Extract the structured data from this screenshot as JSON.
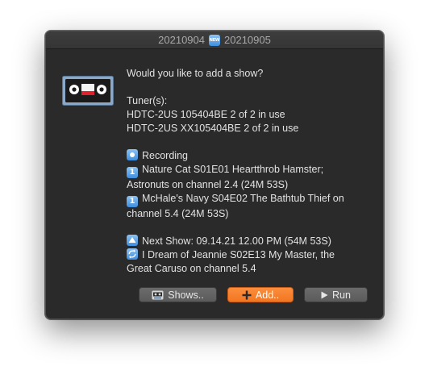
{
  "window": {
    "title_left": "20210904",
    "title_badge": "NEW",
    "title_right": "20210905"
  },
  "message": {
    "question": "Would you like to add a show?",
    "tuners_label": "Tuner(s):",
    "tuners": [
      "HDTC-2US 105404BE 2 of 2 in use",
      "HDTC-2US XX105404BE 2 of 2 in use"
    ],
    "recording_label": "Recording",
    "recordings": [
      {
        "badge": "1",
        "line1": "Nature Cat S01E01 Heartthrob Hamster;",
        "line2": "Astronuts on channel 2.4 (24M 53S)"
      },
      {
        "badge": "1",
        "line1": "McHale's Navy S04E02 The Bathtub Thief on",
        "line2": "channel 5.4 (24M 53S)"
      }
    ],
    "next_show": "Next Show: 09.14.21 12.00 PM (54M 53S)",
    "next_show_detail_line1": "I Dream of Jeannie S02E13 My Master, the",
    "next_show_detail_line2": "Great Caruso on channel 5.4"
  },
  "buttons": {
    "shows": "Shows..",
    "add": "Add..",
    "run": "Run"
  },
  "colors": {
    "dialog_bg": "#2a2a2a",
    "accent_orange": "#f27622",
    "badge_blue": "#3e8ddf",
    "text": "#e2e2e2"
  },
  "icons": {
    "app": "vhs-tape-icon",
    "add": "plus-icon",
    "run": "play-icon",
    "shows": "tape-icon"
  }
}
